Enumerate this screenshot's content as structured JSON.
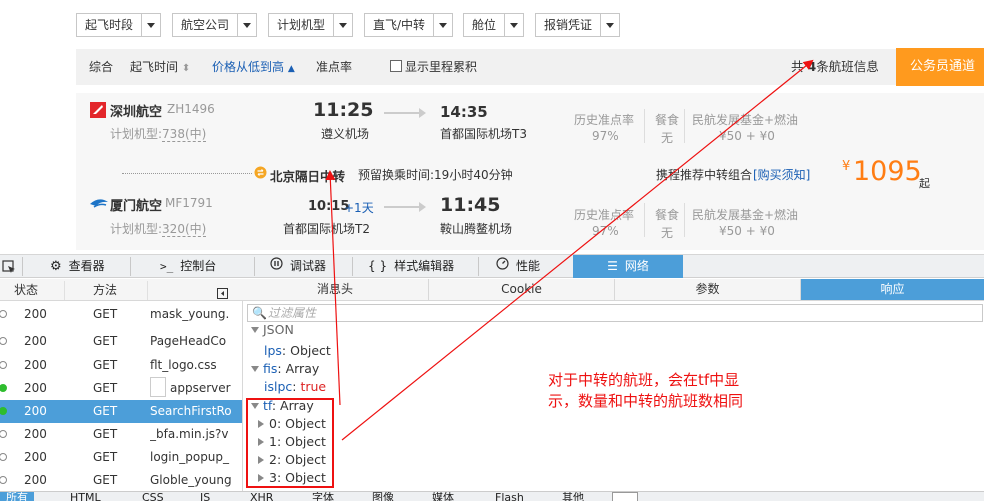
{
  "filters": [
    {
      "label": "起飞时段"
    },
    {
      "label": "航空公司"
    },
    {
      "label": "计划机型"
    },
    {
      "label": "直飞/中转"
    },
    {
      "label": "舱位"
    },
    {
      "label": "报销凭证"
    }
  ],
  "sortbar": {
    "overall": "综合",
    "depart_time": "起飞时间",
    "price_sort": "价格从低到高",
    "ontime": "准点率",
    "show_mileage": "显示里程累积",
    "count_prefix": "共",
    "count": "4",
    "count_suffix": "条航班信息",
    "gov_channel": "公务员通道"
  },
  "card": {
    "seg1": {
      "airline": "深圳航空",
      "flight_no": "ZH1496",
      "model_label": "计划机型:",
      "model": "738(中)",
      "dep_time": "11:25",
      "dep_airport": "遵义机场",
      "arr_time": "14:35",
      "arr_airport": "首都国际机场T3",
      "ontime_label": "历史准点率",
      "ontime_value": "97%",
      "meal_label": "餐食",
      "meal_value": "无",
      "fee_label": "民航发展基金+燃油",
      "fee_value": "¥50 + ¥0"
    },
    "transfer": {
      "text": "北京隔日中转",
      "wait_label": "预留换乘时间:",
      "wait_value": "19小时40分钟",
      "recommend": "携程推荐中转组合",
      "notice": "[购买须知]",
      "price_symbol": "¥",
      "price": "1095",
      "price_suffix": "起"
    },
    "seg2": {
      "airline": "厦门航空",
      "flight_no": "MF1791",
      "model_label": "计划机型:",
      "model": "320(中)",
      "dep_time": "10:15",
      "plus_day": "+1天",
      "dep_airport": "首都国际机场T2",
      "arr_time": "11:45",
      "arr_airport": "鞍山腾鳌机场",
      "ontime_label": "历史准点率",
      "ontime_value": "97%",
      "meal_label": "餐食",
      "meal_value": "无",
      "fee_label": "民航发展基金+燃油",
      "fee_value": "¥50 + ¥0"
    }
  },
  "devtools": {
    "tabs": [
      "查看器",
      "控制台",
      "调试器",
      "样式编辑器",
      "性能",
      "网络"
    ],
    "columns": {
      "status": "状态",
      "method": "方法"
    },
    "detail_tabs": [
      "消息头",
      "Cookie",
      "参数",
      "响应"
    ],
    "filter_placeholder": "过滤属性",
    "requests": [
      {
        "status": "200",
        "method": "GET",
        "file": "mask_young."
      },
      {
        "status": "200",
        "method": "GET",
        "file": "PageHeadCo"
      },
      {
        "status": "200",
        "method": "GET",
        "file": "flt_logo.css"
      },
      {
        "status": "200",
        "method": "GET",
        "file": "appserver"
      },
      {
        "status": "200",
        "method": "GET",
        "file": "SearchFirstRo"
      },
      {
        "status": "200",
        "method": "GET",
        "file": "_bfa.min.js?v"
      },
      {
        "status": "200",
        "method": "GET",
        "file": "login_popup_"
      },
      {
        "status": "200",
        "method": "GET",
        "file": "Globle_young"
      }
    ],
    "json": {
      "root": "JSON",
      "lps_key": "lps",
      "lps_val": "Object",
      "fis_key": "fis",
      "fis_val": "Array",
      "islpc_key": "islpc",
      "islpc_val": "true",
      "tf_key": "tf",
      "tf_val": "Array",
      "tf_items": [
        "0: Object",
        "1: Object",
        "2: Object",
        "3: Object"
      ]
    },
    "bottom_tabs": [
      "所有",
      "HTML",
      "CSS",
      "JS",
      "XHR",
      "字体",
      "图像",
      "媒体",
      "Flash",
      "其他"
    ]
  },
  "annotation": "对于中转的航班，会在tf中显示，数量和中转的航班数相同",
  "colors": {
    "accent_blue": "#4c9ed9",
    "orange": "#ff9a1e",
    "price_orange": "#ff7d13",
    "annotation_red": "#e11111"
  }
}
